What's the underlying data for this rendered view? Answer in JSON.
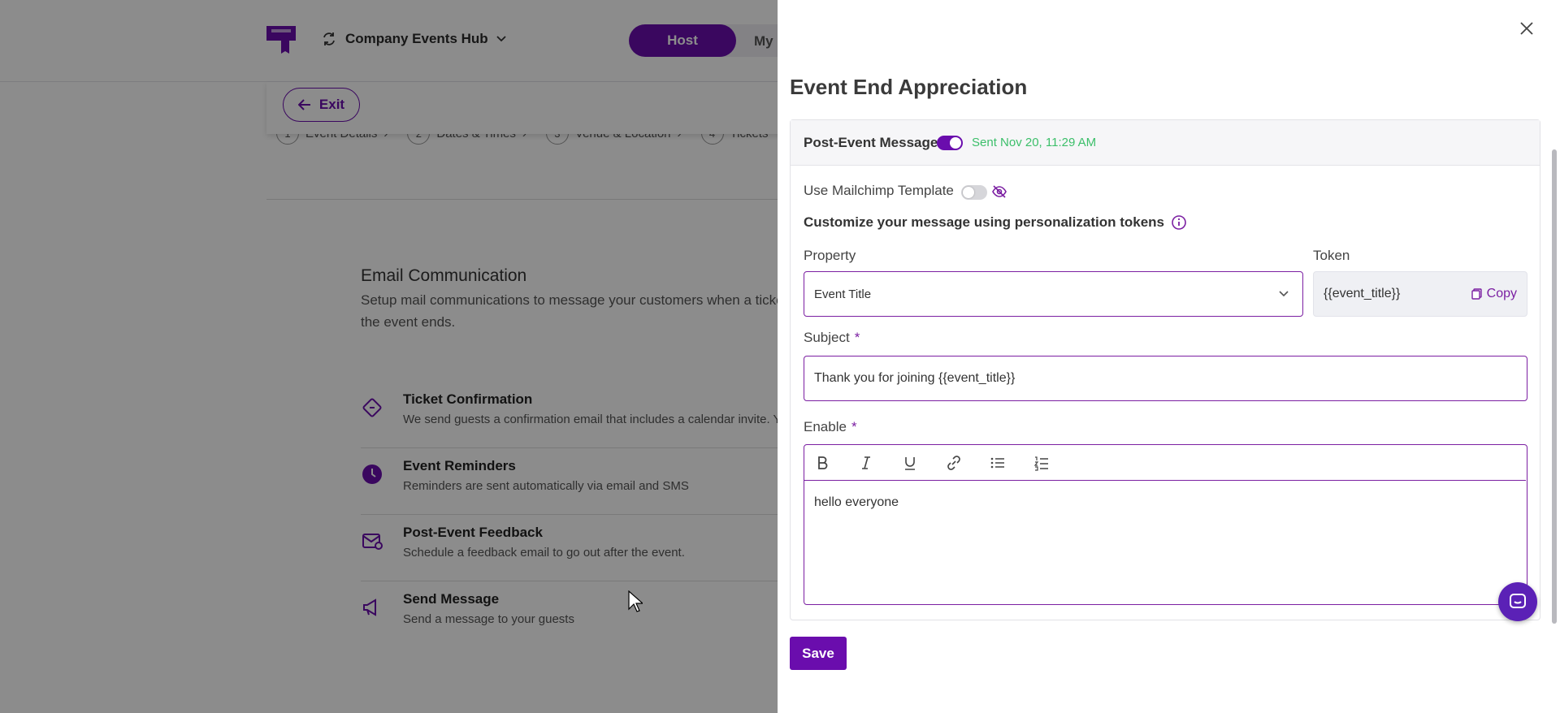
{
  "app": {
    "hub_name": "Company Events Hub",
    "mode_host": "Host",
    "mode_my": "My",
    "exit_label": "Exit"
  },
  "steps": [
    {
      "num": "1",
      "label": "Event Details"
    },
    {
      "num": "2",
      "label": "Dates & Times"
    },
    {
      "num": "3",
      "label": "Venue & Location"
    },
    {
      "num": "4",
      "label": "Tickets"
    }
  ],
  "email": {
    "title": "Email Communication",
    "description": "Setup mail communications to message your customers when a ticket the event ends.",
    "items": [
      {
        "title": "Ticket Confirmation",
        "desc": "We send guests a confirmation email that includes a calendar invite. Yo",
        "icon": "ticket-icon"
      },
      {
        "title": "Event Reminders",
        "desc": "Reminders are sent automatically via email and SMS",
        "icon": "clock-icon"
      },
      {
        "title": "Post-Event Feedback",
        "desc": "Schedule a feedback email to go out after the event.",
        "icon": "feedback-mail-icon"
      },
      {
        "title": "Send Message",
        "desc": "Send a message to your guests",
        "icon": "megaphone-icon"
      }
    ]
  },
  "drawer": {
    "title": "Event End Appreciation",
    "post_event_label": "Post-Event Message",
    "post_event_enabled": true,
    "sent_text": "Sent Nov 20, 11:29 AM",
    "mailchimp_label": "Use Mailchimp Template",
    "mailchimp_enabled": false,
    "customize_label": "Customize your message using personalization tokens",
    "property_label": "Property",
    "property_value": "Event Title",
    "token_label": "Token",
    "token_value": "{{event_title}}",
    "copy_label": "Copy",
    "subject_label": "Subject",
    "required_mark": "*",
    "subject_value": "Thank you for joining {{event_title}}",
    "enable_label": "Enable",
    "editor_toolbar": [
      "bold-icon",
      "italic-icon",
      "underline-icon",
      "link-icon",
      "bullet-list-icon",
      "numbered-list-icon"
    ],
    "editor_body": "hello everyone",
    "save_label": "Save"
  },
  "colors": {
    "accent": "#6a0dad",
    "success": "#3cbf6a",
    "overlay": "rgba(0,0,0,0.45)"
  }
}
